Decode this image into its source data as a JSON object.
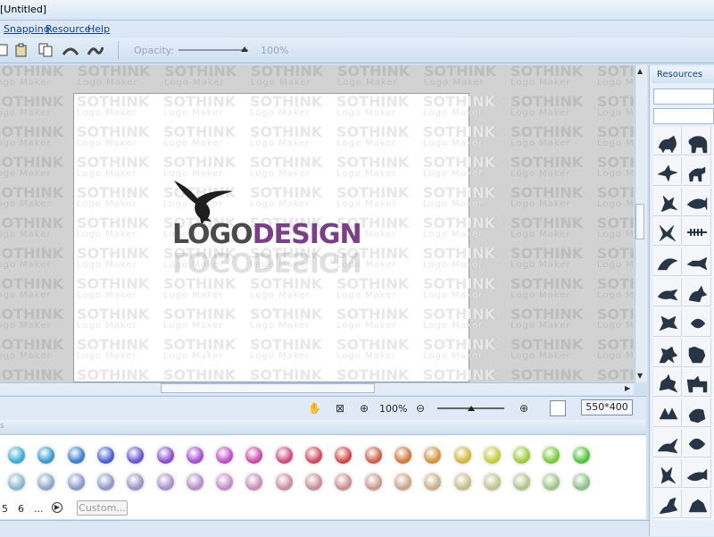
{
  "window": {
    "title": "[Untitled]"
  },
  "menu": {
    "items": [
      "Snapping",
      "Resource",
      "Help"
    ]
  },
  "toolbar": {
    "opacity_label": "Opacity:",
    "opacity_value": "100%"
  },
  "canvas": {
    "watermark_line1": "SOTHINK",
    "watermark_line2": "Logo Maker",
    "logo_text_part1": "LOGO",
    "logo_text_part2": "DESIGN",
    "logo_color_part1": "#4a4a4a",
    "logo_color_part2": "#7a3f86"
  },
  "statusbar": {
    "zoom_value": "100%",
    "canvas_size": "550*400"
  },
  "panel": {
    "tab_label": "s"
  },
  "swatches": {
    "row1": [
      "#3aaed0",
      "#3a9ad0",
      "#3a7fd0",
      "#4a5fd0",
      "#6a55d0",
      "#8a4ed0",
      "#a64ed0",
      "#c04ec8",
      "#cc4aa8",
      "#d04a80",
      "#d04a60",
      "#d04a4a",
      "#d0604a",
      "#d07a3a",
      "#d0983a",
      "#d0b83a",
      "#c8cc3a",
      "#a0cc3a",
      "#7acc3a",
      "#52c43a"
    ],
    "row2": [
      "#8ab8c8",
      "#8aa8c8",
      "#8a9ac8",
      "#9098c8",
      "#9a94c8",
      "#a890c8",
      "#b48ec8",
      "#c28ec4",
      "#c88eb8",
      "#c88ea4",
      "#c88e98",
      "#c89090",
      "#c89a8c",
      "#c8a48a",
      "#c8b08a",
      "#c8bc8a",
      "#c0c48a",
      "#b0c48a",
      "#a0c48a",
      "#90c08a"
    ]
  },
  "pager": {
    "page5": "5",
    "page6": "6",
    "ellipsis": "...",
    "custom_label": "Custom..."
  },
  "resources": {
    "title": "Resources"
  }
}
